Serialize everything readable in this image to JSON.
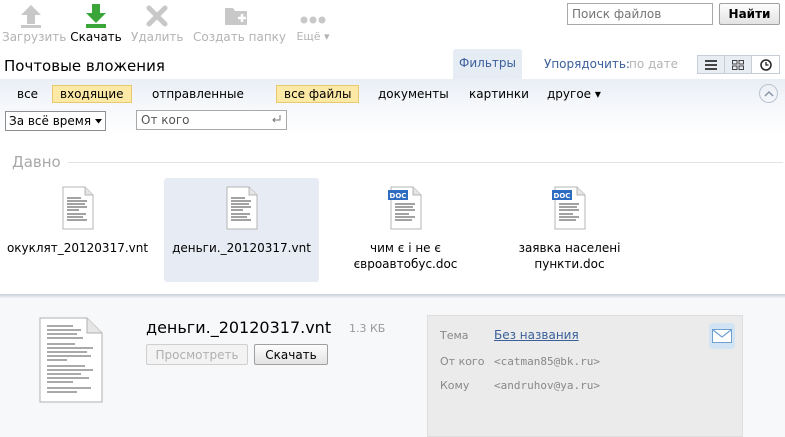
{
  "toolbar": {
    "upload_label": "Загрузить",
    "download_label": "Скачать",
    "delete_label": "Удалить",
    "create_folder_label": "Создать папку",
    "more_label": "Ещё ▾",
    "search_placeholder": "Поиск файлов",
    "search_button": "Найти"
  },
  "header": {
    "title": "Почтовые вложения",
    "filters_tab": "Фильтры",
    "sort_label": "Упорядочить:",
    "sort_value": "по дате"
  },
  "filters": {
    "direction": [
      "все",
      "входящие",
      "отправленные"
    ],
    "direction_selected": "входящие",
    "types": [
      "все файлы",
      "документы",
      "картинки",
      "другое ▾"
    ],
    "type_selected": "все файлы",
    "period_value": "За всё время",
    "from_placeholder": "От кого"
  },
  "section": {
    "title": "Давно"
  },
  "files": [
    {
      "name": "окуклят_20120317.vnt",
      "type": "vnt",
      "selected": false
    },
    {
      "name": "деньги._20120317.vnt",
      "type": "vnt",
      "selected": true
    },
    {
      "name": "чим є і не є\nєвроавтобус.doc",
      "type": "doc",
      "selected": false
    },
    {
      "name": "заявка населені\nпункти.doc",
      "type": "doc",
      "selected": false
    }
  ],
  "preview": {
    "name": "деньги._20120317.vnt",
    "size": "1.3 КБ",
    "view_button": "Просмотреть",
    "download_button": "Скачать",
    "subject_label": "Тема",
    "subject_value": "Без названия",
    "from_label": "От кого",
    "from_value": "<catman85@bk.ru>",
    "to_label": "Кому",
    "to_value": "<andruhov@ya.ru>"
  },
  "colors": {
    "accent": "#3a5f99",
    "chip_selected": "#fde9a6",
    "file_selected": "#e7ebf4",
    "download_icon": "#3aa63a"
  },
  "icons": [
    "upload-icon",
    "download-icon",
    "delete-icon",
    "create-folder-icon",
    "more-icon",
    "list-view-icon",
    "grid-view-icon",
    "clock-view-icon",
    "collapse-icon",
    "enter-icon",
    "document-icon",
    "mail-icon"
  ]
}
